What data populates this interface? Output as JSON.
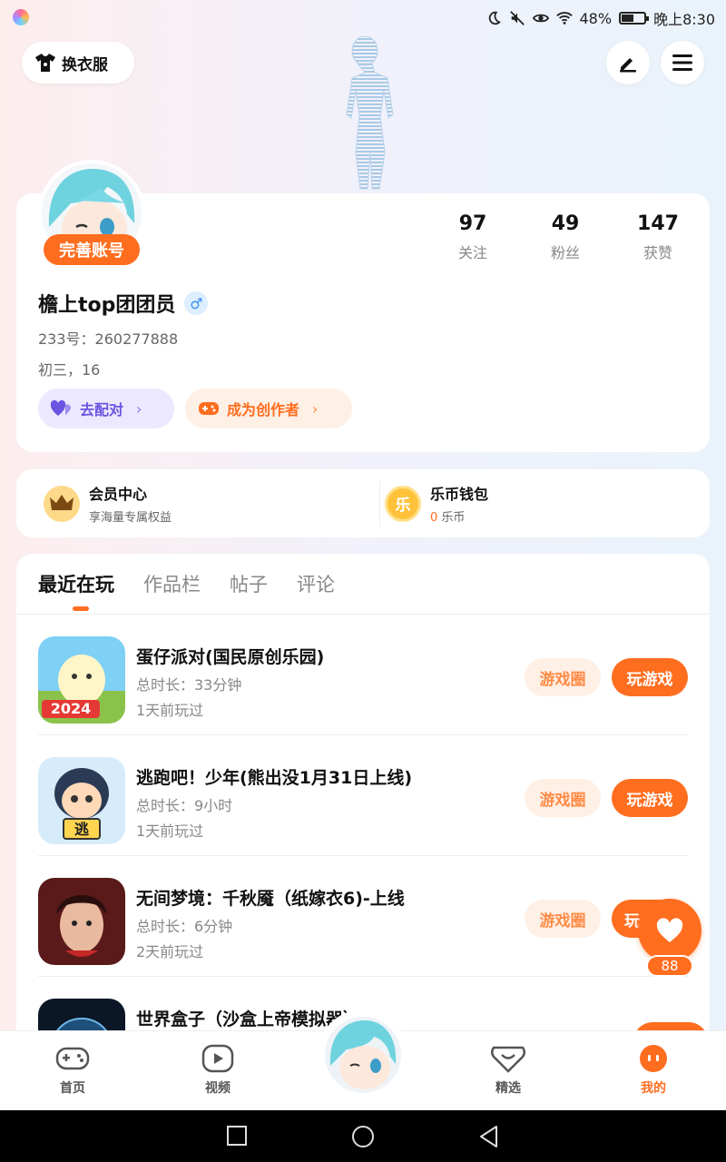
{
  "status_bar": {
    "battery": "48%",
    "battery_level": 0.48,
    "time": "晚上8:30"
  },
  "header": {
    "dress_label": "换衣服"
  },
  "profile": {
    "complete_badge": "完善账号",
    "stats": [
      {
        "num": "97",
        "label": "关注"
      },
      {
        "num": "49",
        "label": "粉丝"
      },
      {
        "num": "147",
        "label": "获赞"
      }
    ],
    "username": "檐上top团团员",
    "gender_symbol": "♂",
    "id_line": "233号：260277888",
    "bio_line": "初三，16",
    "match_label": "去配对",
    "creator_label": "成为创作者"
  },
  "vip": {
    "title": "会员中心",
    "subtitle": "享海量专属权益",
    "wallet_title": "乐币钱包",
    "wallet_amount": "0",
    "wallet_unit": "乐币",
    "wallet_icon_text": "乐"
  },
  "tabs": [
    "最近在玩",
    "作品栏",
    "帖子",
    "评论"
  ],
  "games": [
    {
      "name": "蛋仔派对(国民原创乐园)",
      "duration": "总时长：33分钟",
      "last": "1天前玩过",
      "circle": "游戏圈",
      "play": "玩游戏"
    },
    {
      "name": "逃跑吧！少年(熊出没1月31日上线)",
      "duration": "总时长：9小时",
      "last": "1天前玩过",
      "circle": "游戏圈",
      "play": "玩游戏"
    },
    {
      "name": "无间梦境：千秋魇（纸嫁衣6)-上线",
      "duration": "总时长：6分钟",
      "last": "2天前玩过",
      "circle": "游戏圈",
      "play": "玩"
    },
    {
      "name": "世界盒子（沙盒上帝模拟器）",
      "duration": "",
      "last": "",
      "circle": "",
      "play": ""
    }
  ],
  "game_icon_labels": {
    "year": "2024",
    "escape": "逃"
  },
  "fab": {
    "count": "88"
  },
  "bottom_nav": [
    "首页",
    "视频",
    "精选",
    "我的"
  ],
  "colors": {
    "accent": "#ff6d1f",
    "match": "#6a55e0"
  }
}
